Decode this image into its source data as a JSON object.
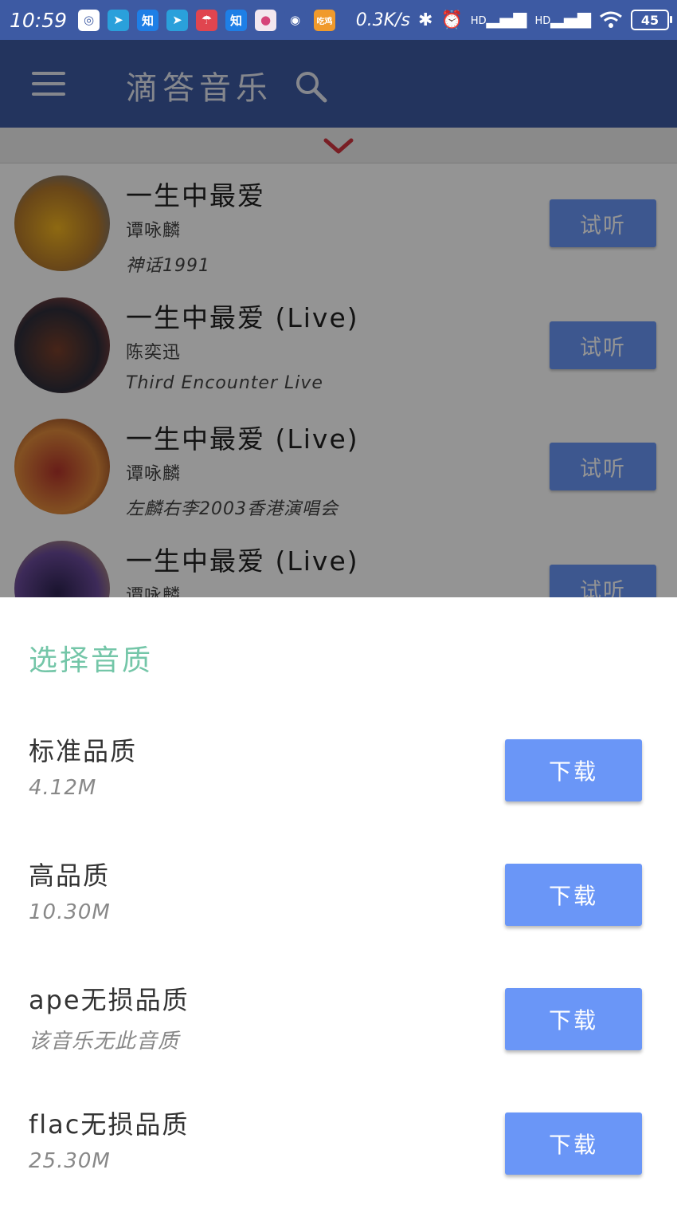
{
  "status_bar": {
    "time": "10:59",
    "speed": "0.3K/s",
    "battery": "45",
    "signal_1": "HD",
    "signal_2": "HD",
    "app_icons": [
      {
        "name": "carrier-icon",
        "glyph": "◎",
        "bg": "#ffffff",
        "fg": "#3d5aa3"
      },
      {
        "name": "telegram-icon",
        "glyph": "➤",
        "bg": "#2aa0db",
        "fg": "#ffffff"
      },
      {
        "name": "zhihu-icon",
        "glyph": "知",
        "bg": "#1e7fe6",
        "fg": "#ffffff"
      },
      {
        "name": "telegram-icon",
        "glyph": "➤",
        "bg": "#2aa0db",
        "fg": "#ffffff"
      },
      {
        "name": "app-red-icon",
        "glyph": "☂",
        "bg": "#e0454f",
        "fg": "#ffffff"
      },
      {
        "name": "zhihu-icon",
        "glyph": "知",
        "bg": "#1e7fe6",
        "fg": "#ffffff"
      },
      {
        "name": "recorder-icon",
        "glyph": "●",
        "bg": "#f3e7ef",
        "fg": "#d6447a"
      },
      {
        "name": "circle-app-icon",
        "glyph": "◉",
        "bg": "#3d5aa3",
        "fg": "#ffffff"
      },
      {
        "name": "game-app-icon",
        "glyph": "吃鸡",
        "bg": "#f09a2c",
        "fg": "#ffffff"
      }
    ]
  },
  "app_bar": {
    "title": "滴答音乐"
  },
  "songs": [
    {
      "title": "一生中最爱",
      "artist": "谭咏麟",
      "album": "神话1991",
      "action": "试听",
      "cover_colors": [
        "#f4b51f",
        "#b4792b",
        "#3a6ab8"
      ]
    },
    {
      "title": "一生中最爱 (Live)",
      "artist": "陈奕迅",
      "album": "Third Encounter Live",
      "action": "试听",
      "cover_colors": [
        "#7a3f2a",
        "#2e2e3a",
        "#c84e3d"
      ]
    },
    {
      "title": "一生中最爱 (Live)",
      "artist": "谭咏麟",
      "album": "左麟右李2003香港演唱会",
      "action": "试听",
      "cover_colors": [
        "#b4342b",
        "#e08a3b",
        "#5a1818"
      ]
    },
    {
      "title": "一生中最爱 (Live)",
      "artist": "谭咏麟",
      "album": "",
      "action": "试听",
      "cover_colors": [
        "#2c2250",
        "#6a4a9a",
        "#e0c060"
      ]
    }
  ],
  "sheet": {
    "title": "选择音质",
    "options": [
      {
        "name": "标准品质",
        "size": "4.12M",
        "button": "下载"
      },
      {
        "name": "高品质",
        "size": "10.30M",
        "button": "下载"
      },
      {
        "name": "ape无损品质",
        "size": "该音乐无此音质",
        "button": "下载"
      },
      {
        "name": "flac无损品质",
        "size": "25.30M",
        "button": "下载"
      }
    ]
  },
  "colors": {
    "primary": "#3d5aa3",
    "accent_button": "#6a96f7",
    "sheet_title": "#74c6a8",
    "chevron": "#d0343f"
  }
}
